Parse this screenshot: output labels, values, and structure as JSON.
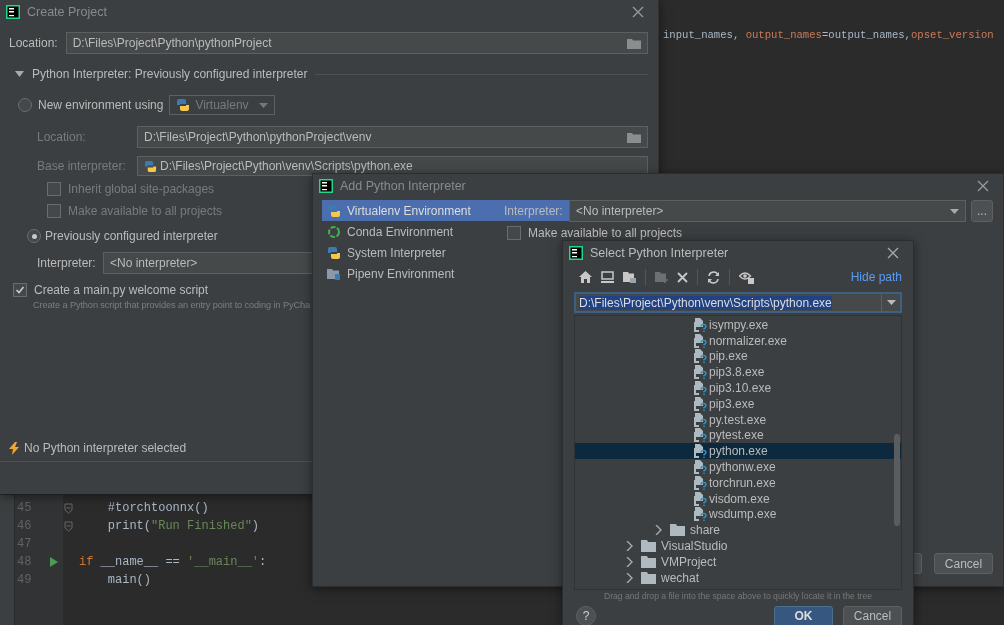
{
  "editor": {
    "top_line": [
      {
        "text": "input_names, ",
        "kind": "plain"
      },
      {
        "text": "output_names",
        "kind": "param"
      },
      {
        "text": "=output_names,",
        "kind": "plain"
      },
      {
        "text": "opset_version",
        "kind": "param"
      }
    ],
    "lines": [
      {
        "number": "45",
        "fold": true,
        "run": false,
        "tokens": [
          {
            "text": "    #torchtoonnx()",
            "kind": "plain"
          }
        ]
      },
      {
        "number": "46",
        "fold": true,
        "run": false,
        "tokens": [
          {
            "text": "    print(",
            "kind": "plain"
          },
          {
            "text": "\"Run Finished\"",
            "kind": "string"
          },
          {
            "text": ")",
            "kind": "plain"
          }
        ]
      },
      {
        "number": "47",
        "fold": false,
        "run": false
      },
      {
        "number": "48",
        "fold": false,
        "run": true,
        "tokens": [
          {
            "text": "if",
            "kind": "keyword"
          },
          {
            "text": " __name__ == ",
            "kind": "plain"
          },
          {
            "text": "'__main__'",
            "kind": "string"
          },
          {
            "text": ":",
            "kind": "plain"
          }
        ]
      },
      {
        "number": "49",
        "fold": false,
        "run": false,
        "tokens": [
          {
            "text": "    main()",
            "kind": "plain"
          }
        ]
      }
    ]
  },
  "create_project": {
    "title": "Create Project",
    "location": {
      "label": "Location:",
      "value": "D:\\Files\\Project\\Python\\pythonProject"
    },
    "interpreter_section": {
      "title": "Python Interpreter: Previously configured interpreter",
      "expanded": true
    },
    "new_environment": {
      "label": "New environment using",
      "selected": false,
      "tool": "Virtualenv",
      "location_label": "Location:",
      "location": "D:\\Files\\Project\\Python\\pythonProject\\venv",
      "base_label": "Base interpreter:",
      "base": "D:\\Files\\Project\\Python\\venv\\Scripts\\python.exe",
      "checkboxes": [
        {
          "label": "Inherit global site-packages",
          "checked": false
        },
        {
          "label": "Make available to all projects",
          "checked": false
        }
      ]
    },
    "previous": {
      "label": "Previously configured interpreter",
      "selected": true,
      "interpreter_label": "Interpreter:",
      "interpreter": "<No interpreter>"
    },
    "welcome_script": {
      "label": "Create a main.py welcome script",
      "checked": true,
      "hint": "Create a Python script that provides an entry point to coding in PyCha"
    },
    "warning": "No Python interpreter selected"
  },
  "add_interpreter": {
    "title": "Add Python Interpreter",
    "environments": [
      {
        "label": "Virtualenv Environment",
        "kind": "virtualenv",
        "selected": true
      },
      {
        "label": "Conda Environment",
        "kind": "conda",
        "selected": false
      },
      {
        "label": "System Interpreter",
        "kind": "system",
        "selected": false
      },
      {
        "label": "Pipenv Environment",
        "kind": "pipenv",
        "selected": false
      }
    ],
    "interpreter_label": "Interpreter:",
    "interpreter": "<No interpreter>",
    "browse": "...",
    "make_available": {
      "label": "Make available to all projects",
      "checked": false
    },
    "cancel": "Cancel"
  },
  "select_dialog": {
    "title": "Select Python Interpreter",
    "toolbar": [
      {
        "kind": "home",
        "disabled": false
      },
      {
        "kind": "desktop",
        "disabled": false
      },
      {
        "kind": "project",
        "disabled": false
      },
      {
        "kind": "new_folder",
        "disabled": true
      },
      {
        "kind": "delete",
        "disabled": false
      },
      {
        "kind": "refresh",
        "disabled": false
      },
      {
        "kind": "hidden",
        "disabled": false
      }
    ],
    "hide_path": "Hide path",
    "path": {
      "value": "D:\\Files\\Project\\Python\\venv\\Scripts\\python.exe",
      "selected": true
    },
    "tree": [
      {
        "children": [
          {
            "children": [
              {
                "label": "isympy.exe",
                "kind": "file",
                "selected": false
              },
              {
                "label": "normalizer.exe",
                "kind": "file",
                "selected": false
              },
              {
                "label": "pip.exe",
                "kind": "file",
                "selected": false
              },
              {
                "label": "pip3.8.exe",
                "kind": "file",
                "selected": false
              },
              {
                "label": "pip3.10.exe",
                "kind": "file",
                "selected": false
              },
              {
                "label": "pip3.exe",
                "kind": "file",
                "selected": false
              },
              {
                "label": "py.test.exe",
                "kind": "file",
                "selected": false
              },
              {
                "label": "pytest.exe",
                "kind": "file",
                "selected": false
              },
              {
                "label": "python.exe",
                "kind": "file",
                "selected": true
              },
              {
                "label": "pythonw.exe",
                "kind": "file",
                "selected": false
              },
              {
                "label": "torchrun.exe",
                "kind": "file",
                "selected": false
              },
              {
                "label": "visdom.exe",
                "kind": "file",
                "selected": false
              },
              {
                "label": "wsdump.exe",
                "kind": "file",
                "selected": false
              }
            ]
          },
          {
            "label": "share",
            "kind": "folder",
            "expanded": false
          }
        ]
      },
      {
        "label": "VisualStudio",
        "kind": "folder",
        "expanded": false
      },
      {
        "label": "VMProject",
        "kind": "folder",
        "expanded": false
      },
      {
        "label": "wechat",
        "kind": "folder",
        "expanded": false
      }
    ],
    "hint": "Drag and drop a file into the space above to quickly locate it in the tree",
    "help": "?",
    "ok": "OK",
    "cancel": "Cancel"
  }
}
